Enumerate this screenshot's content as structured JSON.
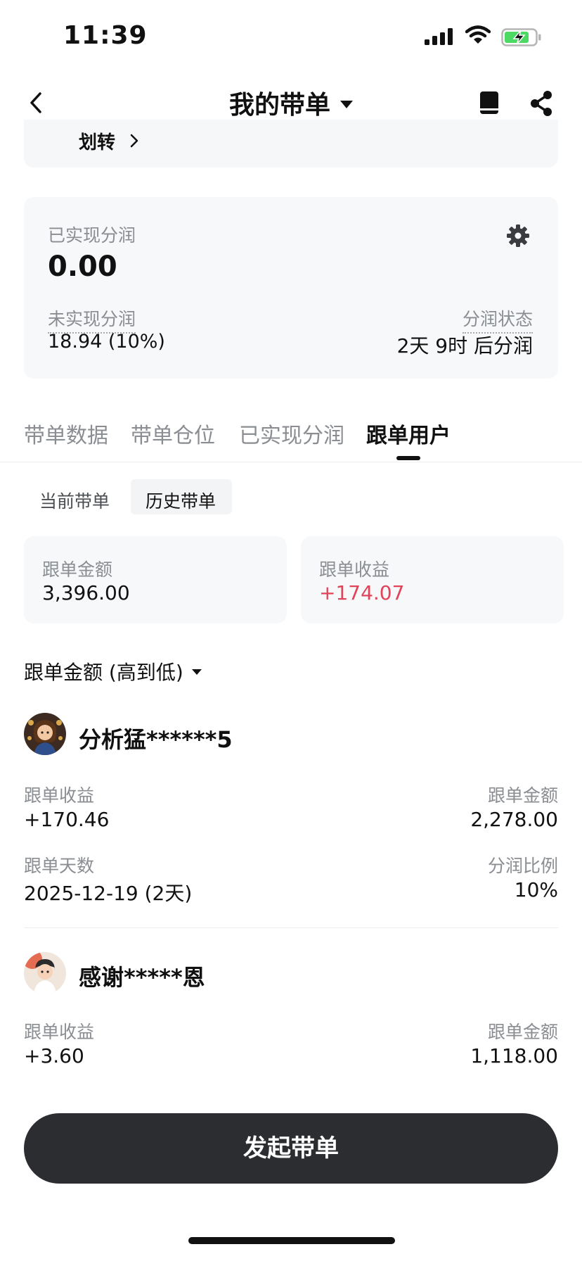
{
  "status_bar": {
    "time": "11:39"
  },
  "nav": {
    "title": "我的带单"
  },
  "transfer": {
    "label": "划转"
  },
  "profit": {
    "realized_label": "已实现分润",
    "realized_value": "0.00",
    "unrealized_label": "未实现分润",
    "unrealized_value": "18.94 (10%)",
    "status_label": "分润状态",
    "status_value": "2天 9时 后分润"
  },
  "tabs": [
    {
      "label": "带单数据"
    },
    {
      "label": "带单仓位"
    },
    {
      "label": "已实现分润"
    },
    {
      "label": "跟单用户"
    }
  ],
  "sub_tabs": [
    {
      "label": "当前带单"
    },
    {
      "label": "历史带单"
    }
  ],
  "stats": {
    "amount_label": "跟单金额",
    "amount_value": "3,396.00",
    "profit_label": "跟单收益",
    "profit_value": "+174.07"
  },
  "sort": {
    "label": "跟单金额 (高到低)"
  },
  "users": [
    {
      "name": "分析猛******5",
      "profit_label": "跟单收益",
      "profit_value": "+170.46",
      "amount_label": "跟单金额",
      "amount_value": "2,278.00",
      "days_label": "跟单天数",
      "days_value": "2025-12-19 (2天)",
      "ratio_label": "分润比例",
      "ratio_value": "10%"
    },
    {
      "name": "感谢*****恩",
      "profit_label": "跟单收益",
      "profit_value": "+3.60",
      "amount_label": "跟单金额",
      "amount_value": "1,118.00"
    }
  ],
  "cta": {
    "label": "发起带单"
  },
  "colors": {
    "positive": "#e0445a",
    "cta_bg": "#2b2d31",
    "battery_green": "#4cd964"
  }
}
